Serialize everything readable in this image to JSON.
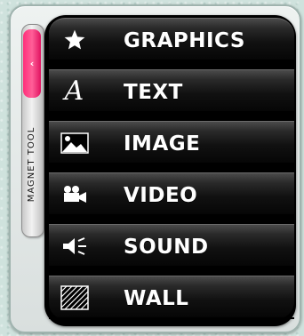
{
  "side_tab": {
    "label": "MAGNET TOOL",
    "collapse_glyph": "‹",
    "accent_color": "#ff2e7a"
  },
  "menu": {
    "items": [
      {
        "label": "GRAPHICS",
        "icon": "star-icon"
      },
      {
        "label": "TEXT",
        "icon": "text-a-icon",
        "glyph": "A"
      },
      {
        "label": "IMAGE",
        "icon": "image-icon"
      },
      {
        "label": "VIDEO",
        "icon": "video-camera-icon"
      },
      {
        "label": "SOUND",
        "icon": "speaker-icon"
      },
      {
        "label": "WALL",
        "icon": "wall-pattern-icon"
      }
    ]
  }
}
